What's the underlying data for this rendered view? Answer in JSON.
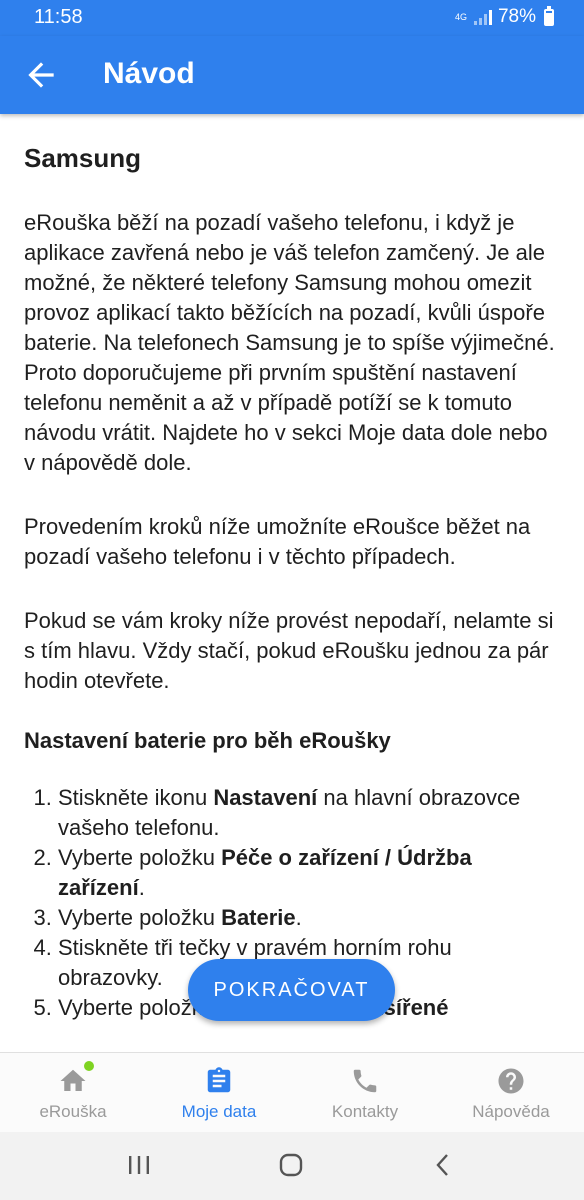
{
  "status_bar": {
    "time": "11:58",
    "network": "4G",
    "battery": "78%",
    "battery_level": 0.78
  },
  "app_bar": {
    "title": "Návod"
  },
  "content": {
    "title": "Samsung",
    "paragraphs": [
      "eRouška běží na pozadí vašeho telefonu, i když je aplikace zavřená nebo je váš telefon zamčený. Je ale možné, že některé telefony Samsung mohou omezit provoz aplikací takto běžících na pozadí, kvůli úspoře baterie. Na telefonech Samsung je to spíše výjimečné. Proto doporučujeme při prvním spuštění nastavení telefonu neměnit a až v případě potíží se k tomuto návodu vrátit. Najdete ho v sekci Moje data dole nebo v nápovědě dole.",
      "Provedením kroků níže umožníte eRoušce běžet na pozadí vašeho telefonu i v těchto případech.",
      "Pokud se vám kroky níže provést nepodaří, nelamte si s tím hlavu. Vždy stačí, pokud eRoušku jednou za pár hodin otevřete."
    ],
    "section_title": "Nastavení baterie pro běh eRoušky",
    "steps": [
      {
        "pre": "Stiskněte ikonu ",
        "bold": "Nastavení",
        "post": " na hlavní obrazovce vašeho telefonu."
      },
      {
        "pre": "Vyberte položku ",
        "bold": "Péče o zařízení / Údržba zařízení",
        "post": "."
      },
      {
        "pre": "Vyberte položku ",
        "bold": "Baterie",
        "post": "."
      },
      {
        "pre": "Stiskněte tři tečky v pravém horním rohu obrazovky.",
        "bold": "",
        "post": ""
      },
      {
        "pre": "Vyberte položku ",
        "bold": "Nastavení / Rozšířené",
        "post": ""
      }
    ]
  },
  "fab": {
    "label": "POKRAČOVAT"
  },
  "bottom_nav": {
    "items": [
      {
        "label": "eRouška",
        "icon": "home-icon"
      },
      {
        "label": "Moje data",
        "icon": "clipboard-icon",
        "active": true
      },
      {
        "label": "Kontakty",
        "icon": "phone-icon"
      },
      {
        "label": "Nápověda",
        "icon": "help-icon"
      }
    ]
  },
  "colors": {
    "primary": "#2f80ed",
    "inactive": "#9a9a9a",
    "badge": "#7ed321"
  }
}
